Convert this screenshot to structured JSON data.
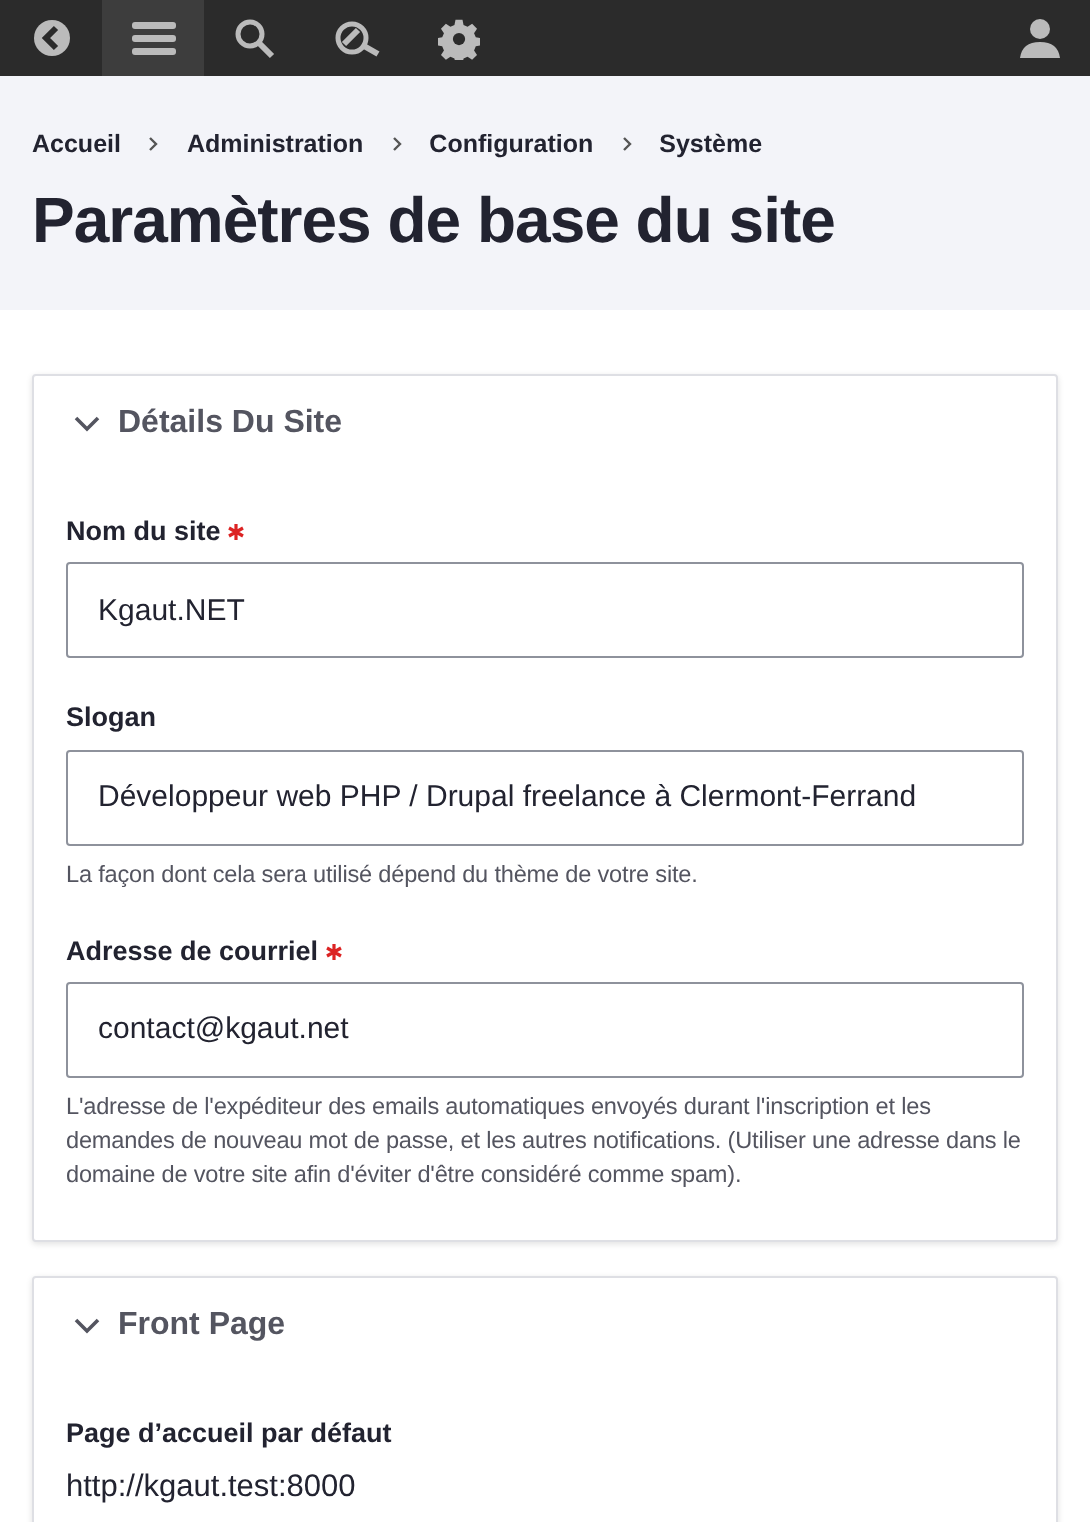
{
  "toolbar": {
    "items": [
      {
        "kind": "back",
        "selected": false
      },
      {
        "kind": "menu",
        "selected": true
      },
      {
        "kind": "search",
        "selected": false
      },
      {
        "kind": "inspect",
        "selected": false
      },
      {
        "kind": "settings",
        "selected": false
      }
    ],
    "user": {
      "kind": "user"
    }
  },
  "breadcrumb": [
    "Accueil",
    "Administration",
    "Configuration",
    "Système"
  ],
  "page_title": "Paramètres de base du site",
  "sections": [
    {
      "title": "Détails Du Site",
      "expanded": true,
      "fields": [
        {
          "kind": "input",
          "label": "Nom du site",
          "required": true,
          "value": "Kgaut.NET"
        },
        {
          "kind": "input",
          "label": "Slogan",
          "required": false,
          "value": "Développeur web PHP / Drupal freelance à Clermont-Ferrand",
          "description": "La façon dont cela sera utilisé dépend du thème de votre site."
        },
        {
          "kind": "input",
          "label": "Adresse de courriel",
          "required": true,
          "value": "contact@kgaut.net",
          "description": "L'adresse de l'expéditeur des emails automatiques envoyés durant l'inscription et les demandes de nouveau mot de passe, et les autres notifications. (Utiliser une adresse dans le domaine de votre site afin d'éviter d'être considéré comme spam)."
        }
      ]
    },
    {
      "title": "Front Page",
      "expanded": true,
      "fields": [
        {
          "kind": "prefix",
          "label": "Page d’accueil par défaut",
          "required": false,
          "value": "http://kgaut.test:8000"
        }
      ]
    }
  ]
}
